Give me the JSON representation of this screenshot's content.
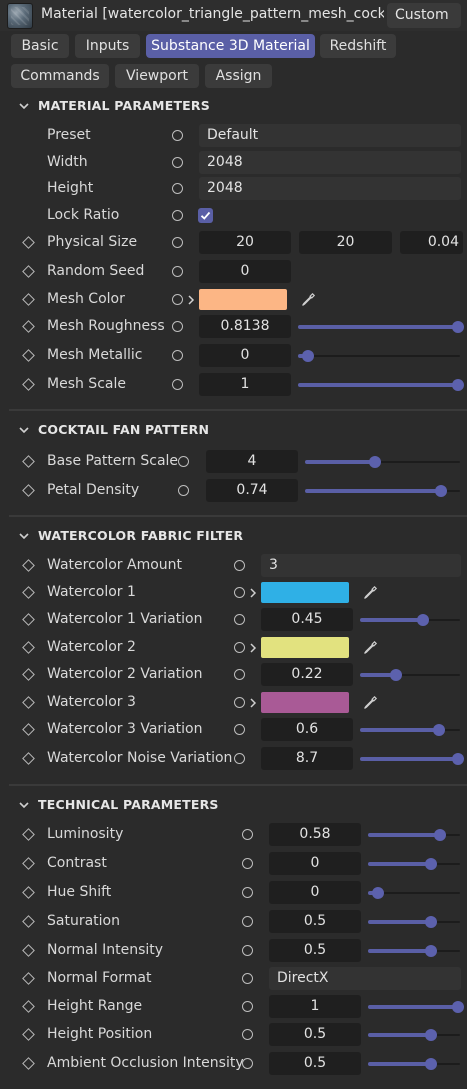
{
  "window": {
    "title": "Material [watercolor_triangle_pattern_mesh_cocktail_...",
    "layout_button": "Custom"
  },
  "tabs": [
    {
      "label": "Basic",
      "active": false
    },
    {
      "label": "Inputs",
      "active": false
    },
    {
      "label": "Substance 3D Material",
      "active": true
    },
    {
      "label": "Redshift",
      "active": false
    },
    {
      "label": "Commands",
      "active": false
    },
    {
      "label": "Viewport",
      "active": false
    },
    {
      "label": "Assign",
      "active": false
    }
  ],
  "colors": {
    "accent": "#5a5fa6",
    "mesh_color": "#fcb685",
    "watercolor_1": "#2fb0e6",
    "watercolor_2": "#e2e27f",
    "watercolor_3": "#a95a96"
  },
  "sections": {
    "material": {
      "title": "MATERIAL PARAMETERS",
      "preset": {
        "label": "Preset",
        "value": "Default"
      },
      "width": {
        "label": "Width",
        "value": "2048"
      },
      "height": {
        "label": "Height",
        "value": "2048"
      },
      "lock_ratio": {
        "label": "Lock Ratio",
        "checked": true
      },
      "physical_size": {
        "label": "Physical Size",
        "x": "20",
        "y": "20",
        "z": "0.04"
      },
      "random_seed": {
        "label": "Random Seed",
        "value": "0"
      },
      "mesh_color": {
        "label": "Mesh Color"
      },
      "mesh_roughness": {
        "label": "Mesh Roughness",
        "value": "0.8138",
        "level": 1.0
      },
      "mesh_metallic": {
        "label": "Mesh Metallic",
        "value": "0",
        "level": 0.0
      },
      "mesh_scale": {
        "label": "Mesh Scale",
        "value": "1",
        "level": 1.0
      }
    },
    "cocktail": {
      "title": "COCKTAIL FAN PATTERN",
      "base_pattern_scale": {
        "label": "Base Pattern Scale",
        "value": "4",
        "level": 0.42
      },
      "petal_density": {
        "label": "Petal Density",
        "value": "0.74",
        "level": 0.88
      }
    },
    "watercolor": {
      "title": "WATERCOLOR FABRIC FILTER",
      "amount": {
        "label": "Watercolor Amount",
        "value": "3"
      },
      "color_1": {
        "label": "Watercolor 1"
      },
      "color_1_variation": {
        "label": "Watercolor 1 Variation",
        "value": "0.45",
        "level": 0.6
      },
      "color_2": {
        "label": "Watercolor 2"
      },
      "color_2_variation": {
        "label": "Watercolor 2 Variation",
        "value": "0.22",
        "level": 0.3
      },
      "color_3": {
        "label": "Watercolor 3"
      },
      "color_3_variation": {
        "label": "Watercolor 3 Variation",
        "value": "0.6",
        "level": 0.78
      },
      "noise_variation": {
        "label": "Watercolor Noise Variation",
        "value": "8.7",
        "level": 1.0
      }
    },
    "technical": {
      "title": "TECHNICAL PARAMETERS",
      "luminosity": {
        "label": "Luminosity",
        "value": "0.58",
        "level": 0.78
      },
      "contrast": {
        "label": "Contrast",
        "value": "0",
        "level": 0.66
      },
      "hue_shift": {
        "label": "Hue Shift",
        "value": "0",
        "level": 0.0
      },
      "saturation": {
        "label": "Saturation",
        "value": "0.5",
        "level": 0.66
      },
      "normal_intensity": {
        "label": "Normal Intensity",
        "value": "0.5",
        "level": 0.66
      },
      "normal_format": {
        "label": "Normal Format",
        "value": "DirectX"
      },
      "height_range": {
        "label": "Height Range",
        "value": "1",
        "level": 1.0
      },
      "height_position": {
        "label": "Height Position",
        "value": "0.5",
        "level": 0.66
      },
      "ao_intensity": {
        "label": "Ambient Occlusion Intensity",
        "value": "0.5",
        "level": 0.66
      }
    }
  }
}
